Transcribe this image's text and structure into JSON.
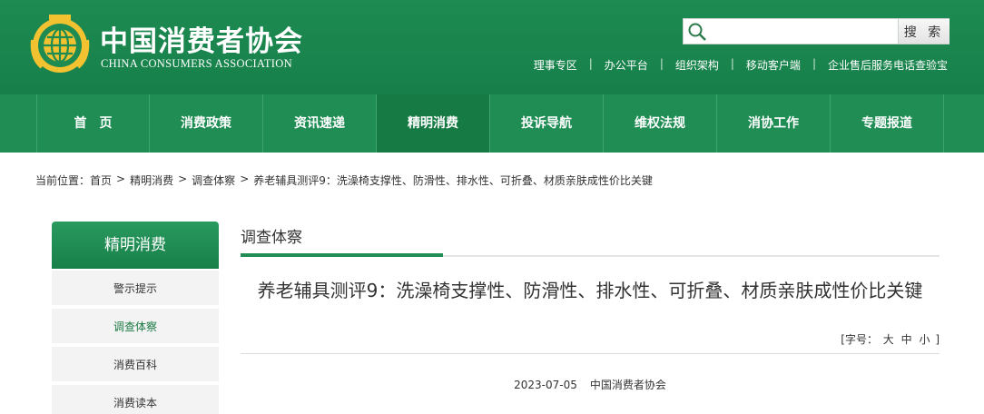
{
  "header": {
    "logo_cn": "中国消费者协会",
    "logo_en": "CHINA CONSUMERS ASSOCIATION",
    "search": {
      "placeholder": "",
      "button_label": "搜 索"
    },
    "top_links": [
      "理事专区",
      "办公平台",
      "组织架构",
      "移动客户端",
      "企业售后服务电话查验宝"
    ]
  },
  "nav": {
    "items": [
      "首　页",
      "消费政策",
      "资讯速递",
      "精明消费",
      "投诉导航",
      "维权法规",
      "消协工作",
      "专题报道"
    ],
    "active_index": 3
  },
  "breadcrumb": {
    "prefix": "当前位置：",
    "items": [
      "首页",
      "精明消费",
      "调查体察",
      "养老辅具测评9：洗澡椅支撑性、防滑性、排水性、可折叠、材质亲肤成性价比关键"
    ]
  },
  "sidebar": {
    "title": "精明消费",
    "items": [
      "警示提示",
      "调查体察",
      "消费百科",
      "消费读本"
    ],
    "active_index": 1
  },
  "main": {
    "section_title": "调查体察",
    "article_title": "养老辅具测评9：洗澡椅支撑性、防滑性、排水性、可折叠、材质亲肤成性价比关键",
    "font_size": {
      "label": "[字号：",
      "large": "大",
      "medium": "中",
      "small": "小",
      "close": "]"
    },
    "date": "2023-07-05",
    "source": "中国消费者协会"
  },
  "colors": {
    "brand_green": "#1f8d54",
    "nav_active": "#157a43",
    "logo_gold": "#f2c230"
  }
}
